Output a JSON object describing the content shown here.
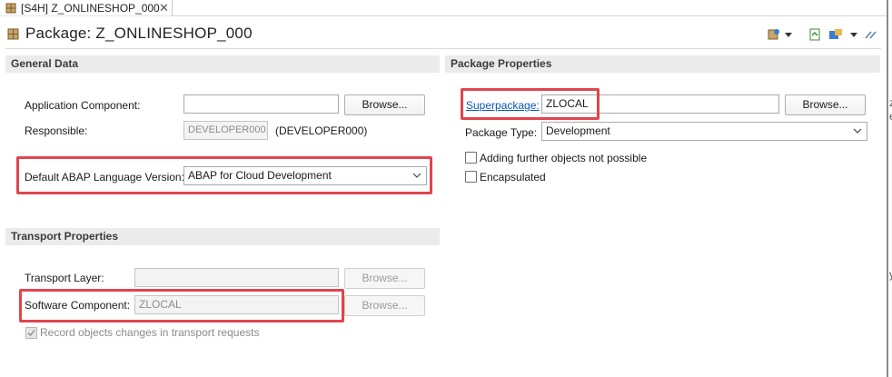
{
  "tab": {
    "title": "[S4H] Z_ONLINESHOP_000",
    "close": "✕"
  },
  "header": {
    "title": "Package: Z_ONLINESHOP_000"
  },
  "general": {
    "section_title": "General Data",
    "app_component_label": "Application Component:",
    "app_component_value": "",
    "browse_label": "Browse...",
    "responsible_label": "Responsible:",
    "responsible_value": "DEVELOPER000",
    "responsible_display": "(DEVELOPER000)",
    "abap_version_label": "Default ABAP Language Version:",
    "abap_version_value": "ABAP for Cloud Development"
  },
  "transport": {
    "section_title": "Transport Properties",
    "layer_label": "Transport Layer:",
    "layer_value": "",
    "software_label": "Software Component:",
    "software_value": "ZLOCAL",
    "browse_label": "Browse...",
    "record_label": "Record objects changes in transport requests",
    "record_checked": true
  },
  "package": {
    "section_title": "Package Properties",
    "superpackage_label": "Superpackage:",
    "superpackage_value": "ZLOCAL",
    "browse_label": "Browse...",
    "type_label": "Package Type:",
    "type_value": "Development",
    "no_further_label": "Adding further objects not possible",
    "encapsulated_label": "Encapsulated",
    "no_further_checked": false,
    "encapsulated_checked": false
  },
  "toolbar": {
    "icons": [
      "package-settings-icon",
      "dropdown-icon",
      "export-icon",
      "transport-icon",
      "dropdown-icon",
      "link-icon"
    ]
  },
  "colors": {
    "highlight": "#e0454d",
    "link": "#0b57b8",
    "section_bg": "#ebebeb"
  },
  "edge_glyphs": [
    "z",
    "e",
    "y"
  ]
}
